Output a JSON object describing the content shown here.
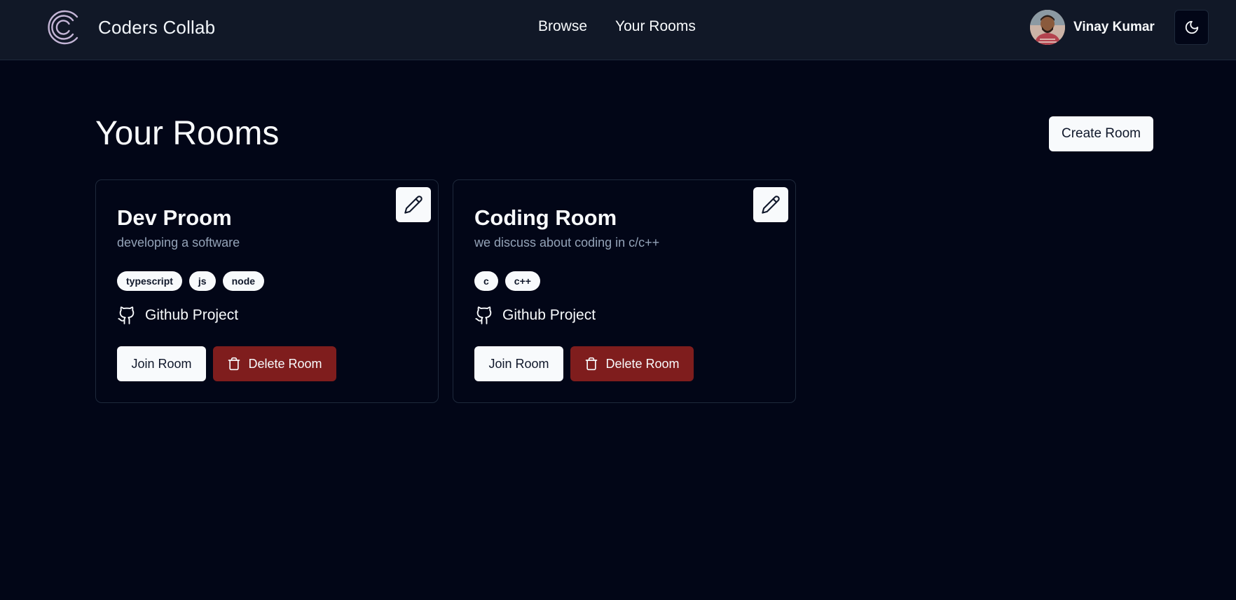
{
  "nav": {
    "brand": "Coders Collab",
    "links": [
      "Browse",
      "Your Rooms"
    ],
    "user_name": "Vinay Kumar",
    "logo_icon": "concentric-c-logo-icon",
    "theme_icon": "moon-icon"
  },
  "page": {
    "title": "Your Rooms",
    "create_label": "Create Room"
  },
  "rooms": [
    {
      "name": "Dev Proom",
      "description": "developing a software",
      "tags": [
        "typescript",
        "js",
        "node"
      ],
      "github_label": "Github Project",
      "join_label": "Join Room",
      "delete_label": "Delete Room"
    },
    {
      "name": "Coding Room",
      "description": "we discuss about coding in c/c++",
      "tags": [
        "c",
        "c++"
      ],
      "github_label": "Github Project",
      "join_label": "Join Room",
      "delete_label": "Delete Room"
    }
  ],
  "colors": {
    "background": "#020617",
    "navbar": "#111827",
    "delete": "#7f1d1d",
    "muted_text": "#94a3b8"
  }
}
